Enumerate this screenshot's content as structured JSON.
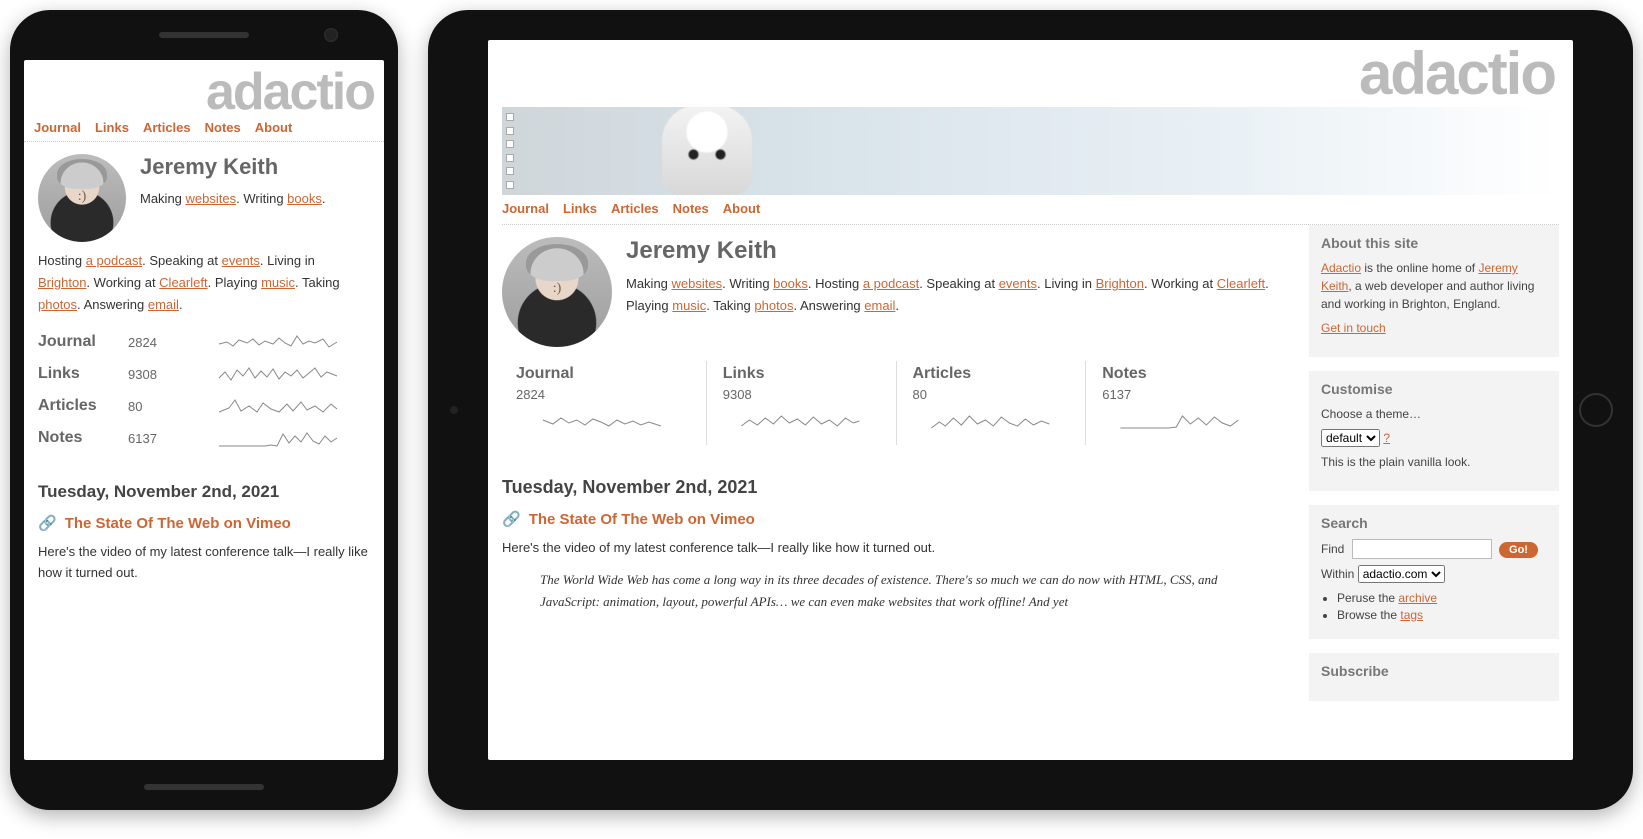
{
  "logo": "adactio",
  "nav": [
    "Journal",
    "Links",
    "Articles",
    "Notes",
    "About"
  ],
  "author": {
    "name": "Jeremy Keith",
    "bio": [
      {
        "text": "Making ",
        "link": "websites"
      },
      {
        "text": "Writing ",
        "link": "books"
      },
      {
        "text": "Hosting ",
        "link": "a podcast"
      },
      {
        "text": "Speaking at ",
        "link": "events"
      },
      {
        "text": "Living in ",
        "link": "Brighton"
      },
      {
        "text": "Working at ",
        "link": "Clearleft"
      },
      {
        "text": "Playing ",
        "link": "music"
      },
      {
        "text": "Taking ",
        "link": "photos"
      },
      {
        "text": "Answering ",
        "link": "email"
      }
    ]
  },
  "stats": [
    {
      "label": "Journal",
      "value": "2824"
    },
    {
      "label": "Links",
      "value": "9308"
    },
    {
      "label": "Articles",
      "value": "80"
    },
    {
      "label": "Notes",
      "value": "6137"
    }
  ],
  "post": {
    "date": "Tuesday, November 2nd, 2021",
    "title": "The State Of The Web on Vimeo",
    "excerpt_short": "Here's the video of my latest conference talk—I really like how it turned out.",
    "excerpt_long": "Here's the video of my latest conference talk—I really like how it turned out.",
    "extended": "The World Wide Web has come a long way in its three decades of existence. There's so much we can do now with HTML, CSS, and JavaScript: animation, layout, powerful APIs… we can even make websites that work offline! And yet"
  },
  "sidebar": {
    "about": {
      "heading": "About this site",
      "text1a": "Adactio",
      "text1b": " is the online home of ",
      "text1c": "Jeremy Keith",
      "text1d": ", a web developer and author living and working in Brighton, England.",
      "contact": "Get in touch"
    },
    "customise": {
      "heading": "Customise",
      "label": "Choose a theme…",
      "selected": "default",
      "help": "?",
      "note": "This is the plain vanilla look."
    },
    "search": {
      "heading": "Search",
      "find_label": "Find",
      "go": "Go!",
      "within_label": "Within",
      "within_selected": "adactio.com",
      "peruse": "Peruse the ",
      "peruse_link": "archive",
      "browse": "Browse the ",
      "browse_link": "tags"
    },
    "subscribe": {
      "heading": "Subscribe"
    }
  }
}
